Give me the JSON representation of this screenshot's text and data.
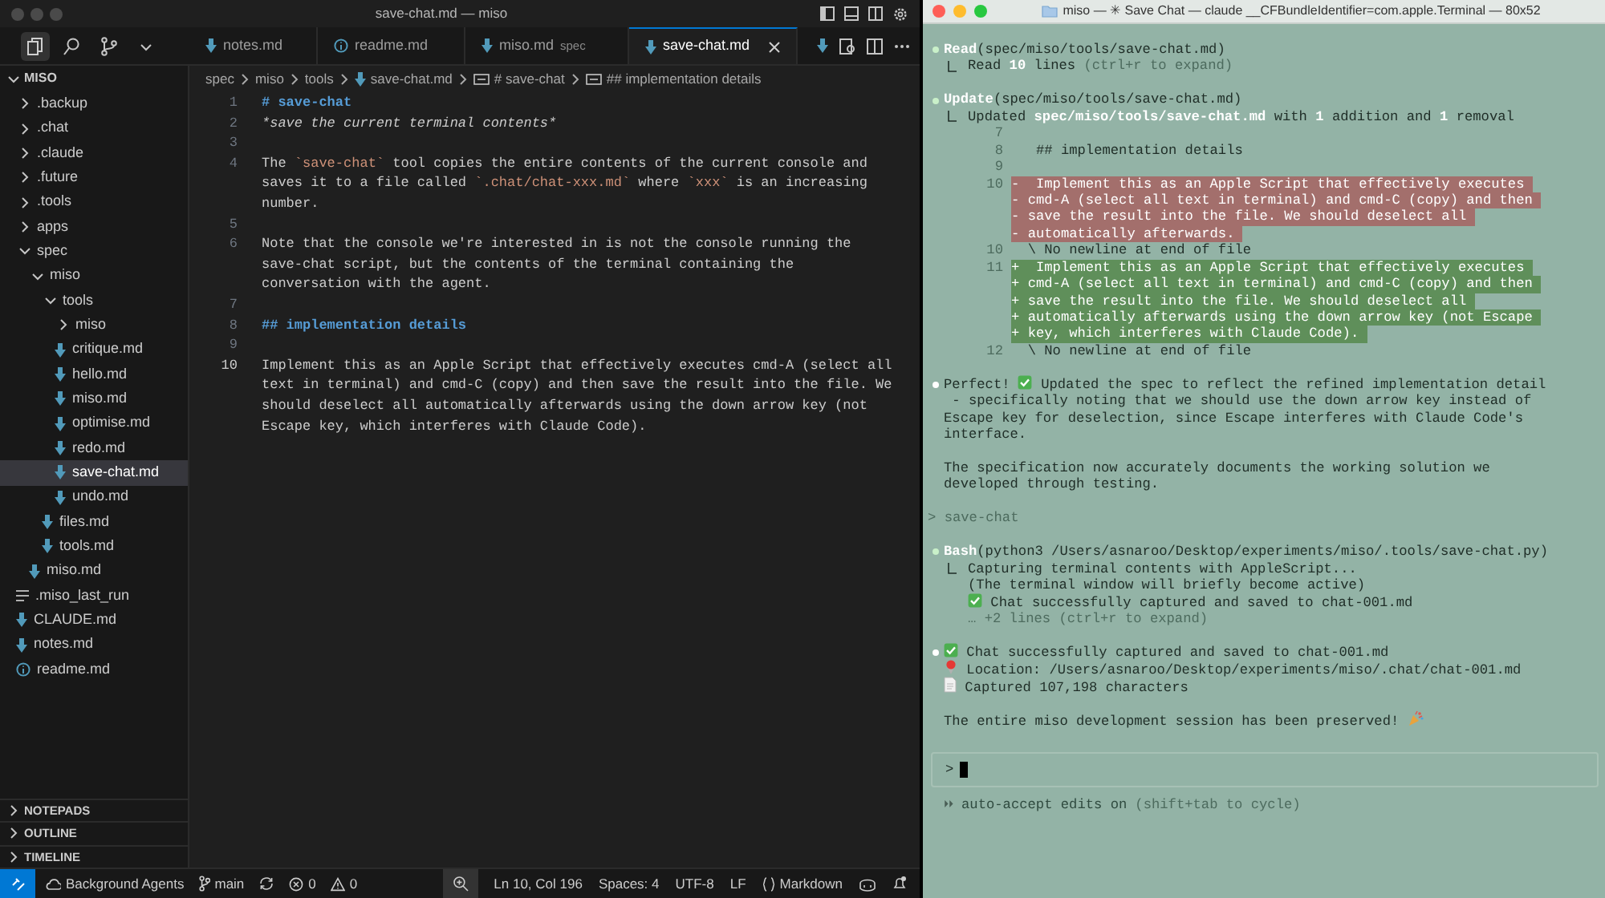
{
  "editor_window": {
    "title": "save-chat.md — miso",
    "activity": [
      {
        "kind": "explorer",
        "selected": true
      },
      {
        "kind": "search",
        "selected": false
      },
      {
        "kind": "source_control",
        "selected": false
      },
      {
        "kind": "more",
        "selected": false
      }
    ],
    "tabs": [
      {
        "label": "notes.md",
        "kind": "markdown",
        "selected": false
      },
      {
        "label": "readme.md",
        "kind": "info",
        "selected": false
      },
      {
        "label": "miso.md",
        "detail": "spec",
        "kind": "markdown",
        "selected": false
      },
      {
        "label": "save-chat.md",
        "kind": "markdown",
        "selected": true
      }
    ],
    "breadcrumbs": [
      {
        "kind": "folder",
        "text": "spec"
      },
      {
        "kind": "folder",
        "text": "miso"
      },
      {
        "kind": "folder",
        "text": "tools"
      },
      {
        "kind": "markdown",
        "text": "save-chat.md"
      },
      {
        "kind": "symbol",
        "text": "# save-chat"
      },
      {
        "kind": "symbol",
        "text": "## implementation details"
      }
    ],
    "explorer": {
      "root": "MISO",
      "expanded": true,
      "items": [
        {
          "label": ".backup",
          "kind": "folder",
          "expanded": false
        },
        {
          "label": ".chat",
          "kind": "folder",
          "expanded": false
        },
        {
          "label": ".claude",
          "kind": "folder",
          "expanded": false
        },
        {
          "label": ".future",
          "kind": "folder",
          "expanded": false
        },
        {
          "label": ".tools",
          "kind": "folder",
          "expanded": false
        },
        {
          "label": "apps",
          "kind": "folder",
          "expanded": false
        },
        {
          "label": "spec",
          "kind": "folder",
          "expanded": true,
          "children": [
            {
              "label": "miso",
              "kind": "folder",
              "expanded": true,
              "children": [
                {
                  "label": "tools",
                  "kind": "folder",
                  "expanded": true,
                  "children": [
                    {
                      "label": "miso",
                      "kind": "folder",
                      "expanded": false
                    },
                    {
                      "label": "critique.md",
                      "kind": "markdown",
                      "selected": false
                    },
                    {
                      "label": "hello.md",
                      "kind": "markdown",
                      "selected": false
                    },
                    {
                      "label": "miso.md",
                      "kind": "markdown",
                      "selected": false
                    },
                    {
                      "label": "optimise.md",
                      "kind": "markdown",
                      "selected": false
                    },
                    {
                      "label": "redo.md",
                      "kind": "markdown",
                      "selected": false
                    },
                    {
                      "label": "save-chat.md",
                      "kind": "markdown",
                      "selected": true
                    },
                    {
                      "label": "undo.md",
                      "kind": "markdown",
                      "selected": false
                    }
                  ]
                },
                {
                  "label": "files.md",
                  "kind": "markdown",
                  "selected": false
                },
                {
                  "label": "tools.md",
                  "kind": "markdown",
                  "selected": false
                }
              ]
            },
            {
              "label": "miso.md",
              "kind": "markdown",
              "selected": false
            }
          ]
        },
        {
          "label": ".miso_last_run",
          "kind": "text",
          "selected": false
        },
        {
          "label": "CLAUDE.md",
          "kind": "markdown",
          "selected": false
        },
        {
          "label": "notes.md",
          "kind": "markdown",
          "selected": false
        },
        {
          "label": "readme.md",
          "kind": "info",
          "selected": false
        }
      ]
    },
    "panels": [
      {
        "label": "NOTEPADS",
        "expanded": false
      },
      {
        "label": "OUTLINE",
        "expanded": false
      },
      {
        "label": "TIMELINE",
        "expanded": false
      }
    ],
    "lines": [
      {
        "number": "1",
        "segments": [
          {
            "kind": "heading",
            "text": "# save-chat"
          }
        ]
      },
      {
        "number": "2",
        "segments": [
          {
            "kind": "emphasis",
            "text": "*save the current terminal contents*"
          }
        ]
      },
      {
        "number": "3"
      },
      {
        "number": "4",
        "segments": [
          {
            "kind": "plain",
            "text": "The "
          },
          {
            "kind": "code",
            "text": "`save-chat`"
          },
          {
            "kind": "plain",
            "text": " tool copies the entire contents of the current console and saves it to a file called "
          },
          {
            "kind": "code",
            "text": "`.chat/chat-xxx.md`"
          },
          {
            "kind": "plain",
            "text": " where "
          },
          {
            "kind": "code",
            "text": "`xxx`"
          },
          {
            "kind": "plain",
            "text": " is an increasing number."
          }
        ]
      },
      {
        "number": "5"
      },
      {
        "number": "6",
        "segments": [
          {
            "kind": "plain",
            "text": "Note that the console we're interested in is not the console running the save-chat script, but the contents of the terminal containing the conversation with the agent."
          }
        ]
      },
      {
        "number": "7"
      },
      {
        "number": "8",
        "segments": [
          {
            "kind": "heading",
            "text": "## implementation details"
          }
        ]
      },
      {
        "number": "9"
      },
      {
        "number": "10",
        "current": true,
        "segments": [
          {
            "kind": "plain",
            "text": "Implement this as an Apple Script that effectively executes cmd-A (select all text in terminal) and cmd-C (copy) and then save the result into the file. We should deselect all automatically afterwards using the down arrow key (not Escape key, which interferes with Claude Code)."
          }
        ]
      }
    ],
    "status_bar": {
      "left": [
        {
          "kind": "agents",
          "text": "Background Agents"
        },
        {
          "kind": "branch",
          "text": "main"
        },
        {
          "kind": "sync"
        },
        {
          "kind": "errors",
          "text": "0"
        },
        {
          "kind": "warnings",
          "text": "0"
        }
      ],
      "right": [
        {
          "kind": "zoom"
        },
        {
          "kind": "text",
          "text": "Ln 10, Col 196"
        },
        {
          "kind": "text",
          "text": "Spaces: 4"
        },
        {
          "kind": "text",
          "text": "UTF-8"
        },
        {
          "kind": "text",
          "text": "LF"
        },
        {
          "kind": "language",
          "text": "Markdown"
        },
        {
          "kind": "copilot"
        },
        {
          "kind": "bell"
        }
      ]
    }
  },
  "terminal": {
    "title": "miso — ✳ Save Chat — claude __CFBundleIdentifier=com.apple.Terminal — 80x52",
    "lines": [
      {
        "kind": "tool",
        "segments": [
          {
            "kind": "tool",
            "text": "Read"
          },
          {
            "kind": "plain",
            "text": "(spec/miso/tools/save-chat.md)"
          }
        ]
      },
      {
        "kind": "result",
        "segments": [
          {
            "kind": "plain",
            "text": "Read "
          },
          {
            "kind": "bold",
            "text": "10"
          },
          {
            "kind": "plain",
            "text": " lines "
          },
          {
            "kind": "dim",
            "text": "(ctrl+r to expand)"
          }
        ]
      },
      {
        "kind": "blank"
      },
      {
        "kind": "tool",
        "segments": [
          {
            "kind": "tool",
            "text": "Update"
          },
          {
            "kind": "plain",
            "text": "(spec/miso/tools/save-chat.md)"
          }
        ]
      },
      {
        "kind": "result",
        "segments": [
          {
            "kind": "plain",
            "text": "Updated "
          },
          {
            "kind": "bold",
            "text": "spec/miso/tools/save-chat.md"
          },
          {
            "kind": "plain",
            "text": " with "
          },
          {
            "kind": "bold",
            "text": "1"
          },
          {
            "kind": "plain",
            "text": " addition and "
          },
          {
            "kind": "bold",
            "text": "1"
          },
          {
            "kind": "plain",
            "text": " removal"
          }
        ]
      },
      {
        "kind": "diff_context",
        "number": "7"
      },
      {
        "kind": "diff_context",
        "number": "8",
        "text": "   ## implementation details"
      },
      {
        "kind": "diff_context",
        "number": "9"
      },
      {
        "kind": "diff_removed",
        "number": "10",
        "text": "-  Implement this as an Apple Script that effectively executes"
      },
      {
        "kind": "diff_removed",
        "text": "- cmd-A (select all text in terminal) and cmd-C (copy) and then"
      },
      {
        "kind": "diff_removed",
        "text": "- save the result into the file. We should deselect all"
      },
      {
        "kind": "diff_removed",
        "text": "- automatically afterwards."
      },
      {
        "kind": "diff_context",
        "number": "10",
        "text": "  \\ No newline at end of file"
      },
      {
        "kind": "diff_added",
        "number": "11",
        "text": "+  Implement this as an Apple Script that effectively executes"
      },
      {
        "kind": "diff_added",
        "text": "+ cmd-A (select all text in terminal) and cmd-C (copy) and then"
      },
      {
        "kind": "diff_added",
        "text": "+ save the result into the file. We should deselect all"
      },
      {
        "kind": "diff_added",
        "text": "+ automatically afterwards using the down arrow key (not Escape"
      },
      {
        "kind": "diff_added",
        "text": "+ key, which interferes with Claude Code)."
      },
      {
        "kind": "diff_context",
        "number": "12",
        "text": "  \\ No newline at end of file"
      },
      {
        "kind": "blank"
      },
      {
        "kind": "message",
        "segments": [
          {
            "kind": "plain",
            "text": "Perfect! "
          },
          {
            "kind": "check"
          },
          {
            "kind": "plain",
            "text": " Updated the spec to reflect the refined implementation detail"
          }
        ]
      },
      {
        "kind": "text",
        "segments": [
          {
            "kind": "plain",
            "text": " - specifically noting that we should use the down arrow key instead of"
          }
        ]
      },
      {
        "kind": "text",
        "segments": [
          {
            "kind": "plain",
            "text": "Escape key for deselection, since Escape interferes with Claude Code's"
          }
        ]
      },
      {
        "kind": "text",
        "segments": [
          {
            "kind": "plain",
            "text": "interface."
          }
        ]
      },
      {
        "kind": "blank"
      },
      {
        "kind": "text",
        "segments": [
          {
            "kind": "plain",
            "text": "The specification now accurately documents the working solution we"
          }
        ]
      },
      {
        "kind": "text",
        "segments": [
          {
            "kind": "plain",
            "text": "developed through testing."
          }
        ]
      },
      {
        "kind": "blank"
      },
      {
        "kind": "echo",
        "text": "> save-chat"
      },
      {
        "kind": "blank"
      },
      {
        "kind": "tool",
        "segments": [
          {
            "kind": "tool",
            "text": "Bash"
          },
          {
            "kind": "plain",
            "text": "(python3 /Users/asnaroo/Desktop/experiments/miso/.tools/save-chat.py)"
          }
        ]
      },
      {
        "kind": "result",
        "segments": [
          {
            "kind": "plain",
            "text": "Capturing terminal contents with AppleScript..."
          }
        ]
      },
      {
        "kind": "result_cont",
        "segments": [
          {
            "kind": "plain",
            "text": "(The terminal window will briefly become active)"
          }
        ]
      },
      {
        "kind": "result_cont",
        "segments": [
          {
            "kind": "check"
          },
          {
            "kind": "plain",
            "text": " Chat successfully captured and saved to chat-001.md"
          }
        ]
      },
      {
        "kind": "result_cont",
        "segments": [
          {
            "kind": "dim",
            "text": "… +2 lines (ctrl+r to expand)"
          }
        ]
      },
      {
        "kind": "blank"
      },
      {
        "kind": "message",
        "segments": [
          {
            "kind": "check"
          },
          {
            "kind": "plain",
            "text": " Chat successfully captured and saved to chat-001.md"
          }
        ]
      },
      {
        "kind": "text",
        "segments": [
          {
            "kind": "pin"
          },
          {
            "kind": "plain",
            "text": " Location: /Users/asnaroo/Desktop/experiments/miso/.chat/chat-001.md"
          }
        ]
      },
      {
        "kind": "text",
        "segments": [
          {
            "kind": "file"
          },
          {
            "kind": "plain",
            "text": " Captured 107,198 characters"
          }
        ]
      },
      {
        "kind": "blank"
      },
      {
        "kind": "text",
        "segments": [
          {
            "kind": "plain",
            "text": "The entire miso development session has been preserved! "
          },
          {
            "kind": "party"
          }
        ]
      }
    ],
    "input": {
      "prompt": ">"
    },
    "mode": {
      "marker": "⏵⏵",
      "text": "auto-accept edits on",
      "hint": "(shift+tab to cycle)"
    }
  }
}
